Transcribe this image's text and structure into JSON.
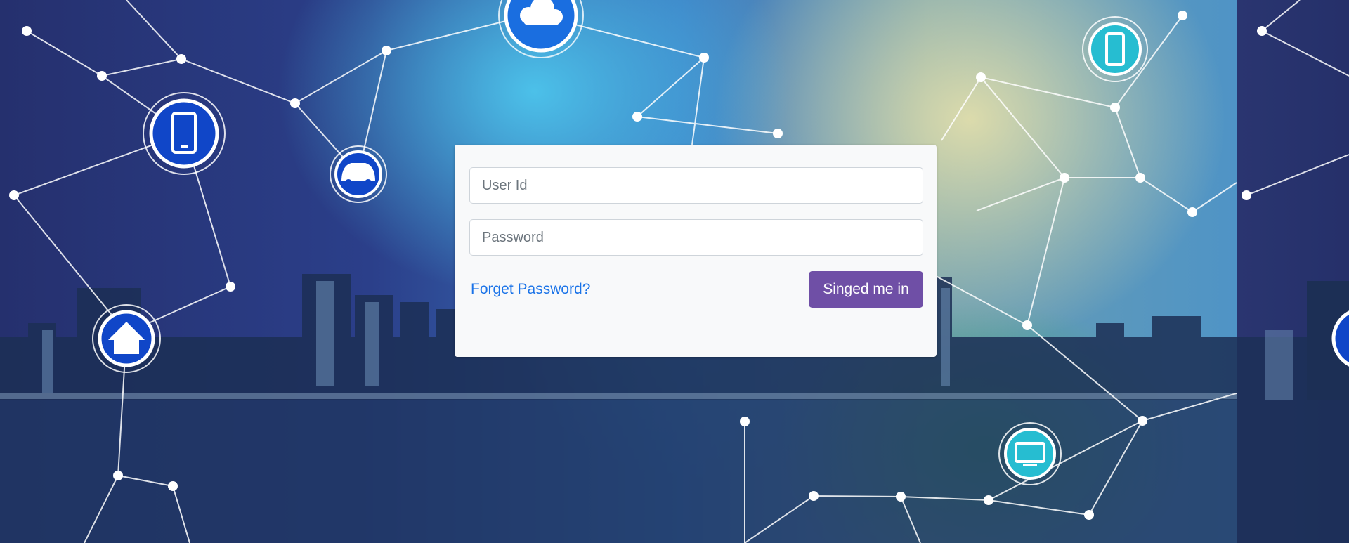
{
  "login": {
    "user_id_placeholder": "User Id",
    "password_placeholder": "Password",
    "forgot_password_label": "Forget Password?",
    "sign_in_label": "Singed me in"
  },
  "background": {
    "icons": [
      "cloud-icon",
      "smartphone-icon",
      "car-icon",
      "home-icon",
      "smartphone-icon",
      "monitor-icon"
    ]
  },
  "colors": {
    "link": "#1a73e8",
    "button": "#6f4fa6",
    "card": "#f8f9fa"
  }
}
